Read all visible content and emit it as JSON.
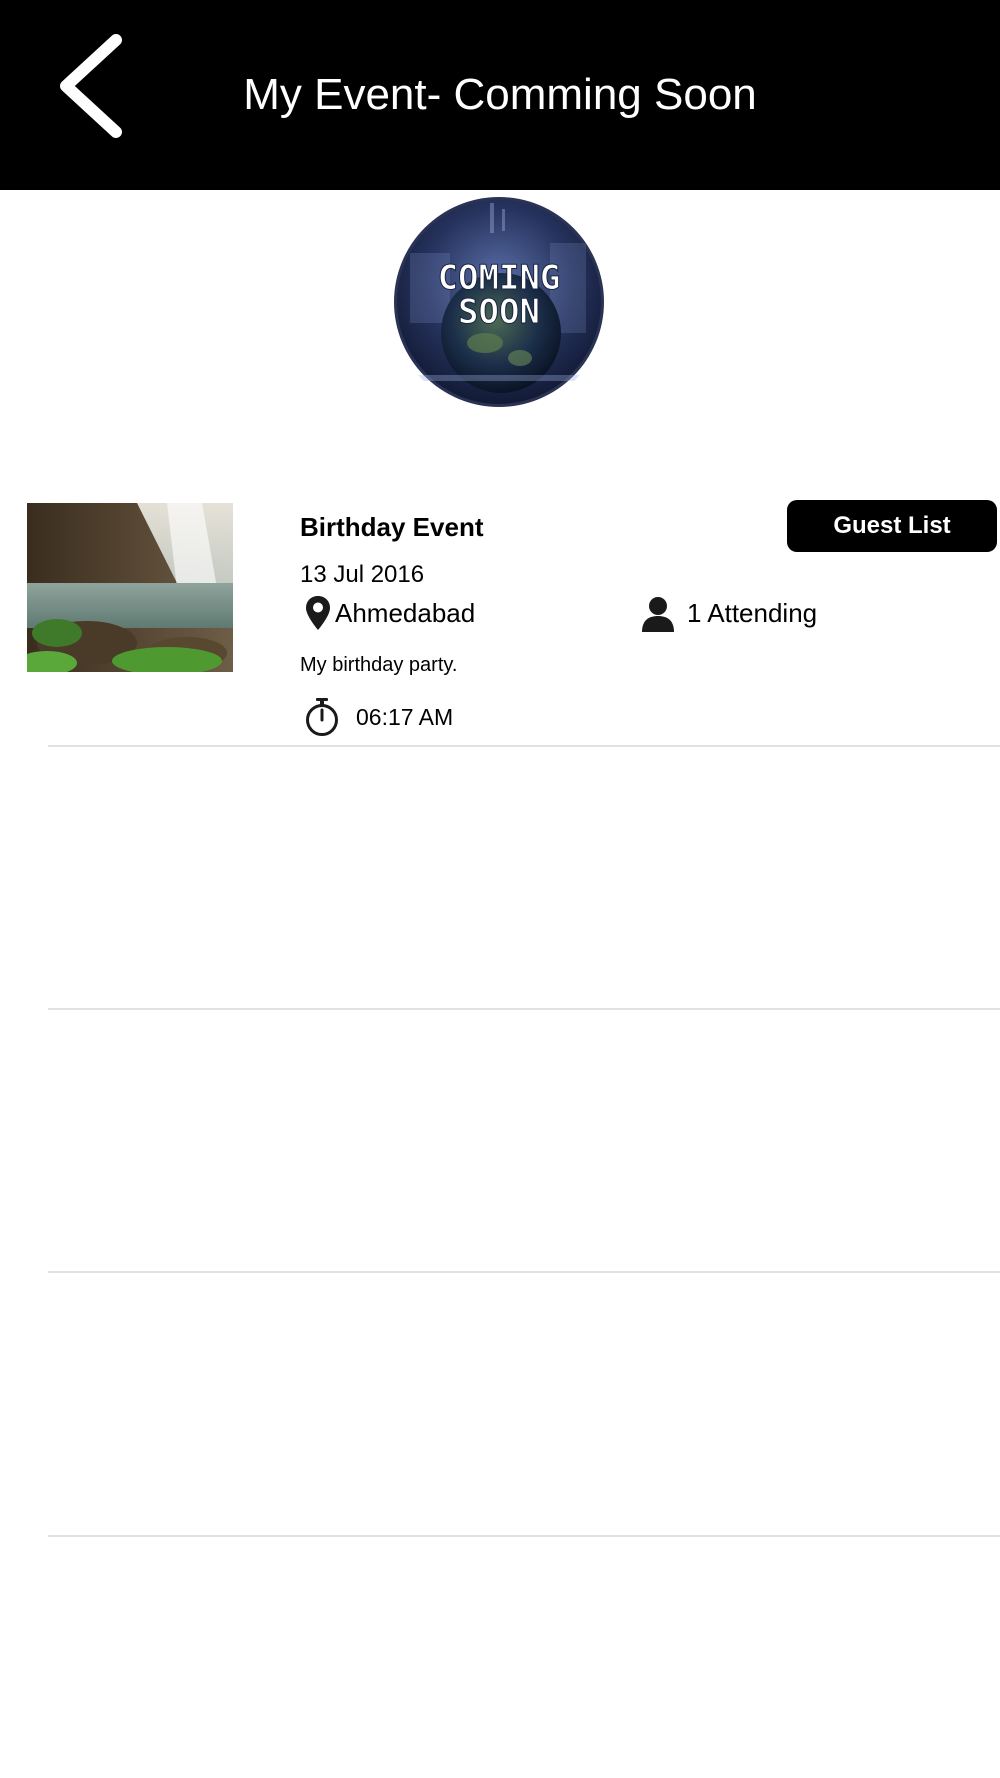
{
  "header": {
    "title": "My Event- Comming Soon",
    "back_icon": "chevron-left-icon"
  },
  "banner": {
    "line1": "COMING",
    "line2": "SOON"
  },
  "event": {
    "title": "Birthday Event",
    "date": "13 Jul 2016",
    "location": "Ahmedabad",
    "attending": "1 Attending",
    "description": "My birthday party.",
    "time": "06:17 AM",
    "guest_list_label": "Guest List",
    "icons": {
      "location": "map-pin-icon",
      "attending": "person-icon",
      "time": "stopwatch-icon"
    }
  },
  "colors": {
    "header_bg": "#000000",
    "button_bg": "#000000",
    "divider": "#e1e1e1"
  }
}
